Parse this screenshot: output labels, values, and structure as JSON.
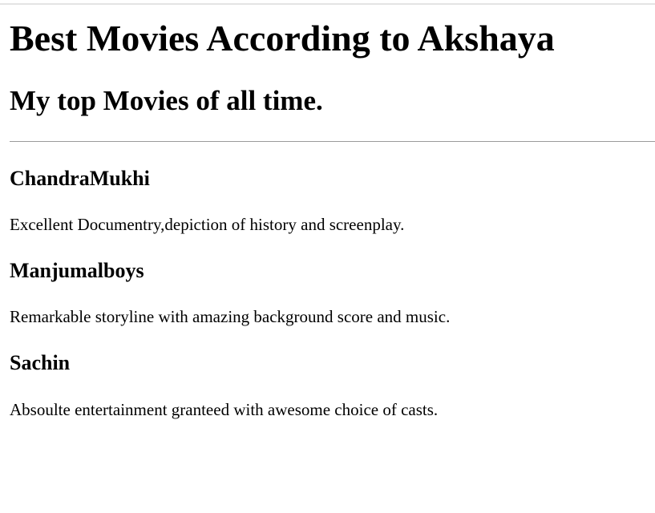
{
  "header": {
    "title": "Best Movies According to Akshaya",
    "subtitle": "My top Movies of all time."
  },
  "movies": [
    {
      "name": "ChandraMukhi",
      "description": "Excellent Documentry,depiction of history and screenplay."
    },
    {
      "name": "Manjumalboys",
      "description": "Remarkable storyline with amazing background score and music."
    },
    {
      "name": "Sachin",
      "description": "Absoulte entertainment granteed with awesome choice of casts."
    }
  ]
}
